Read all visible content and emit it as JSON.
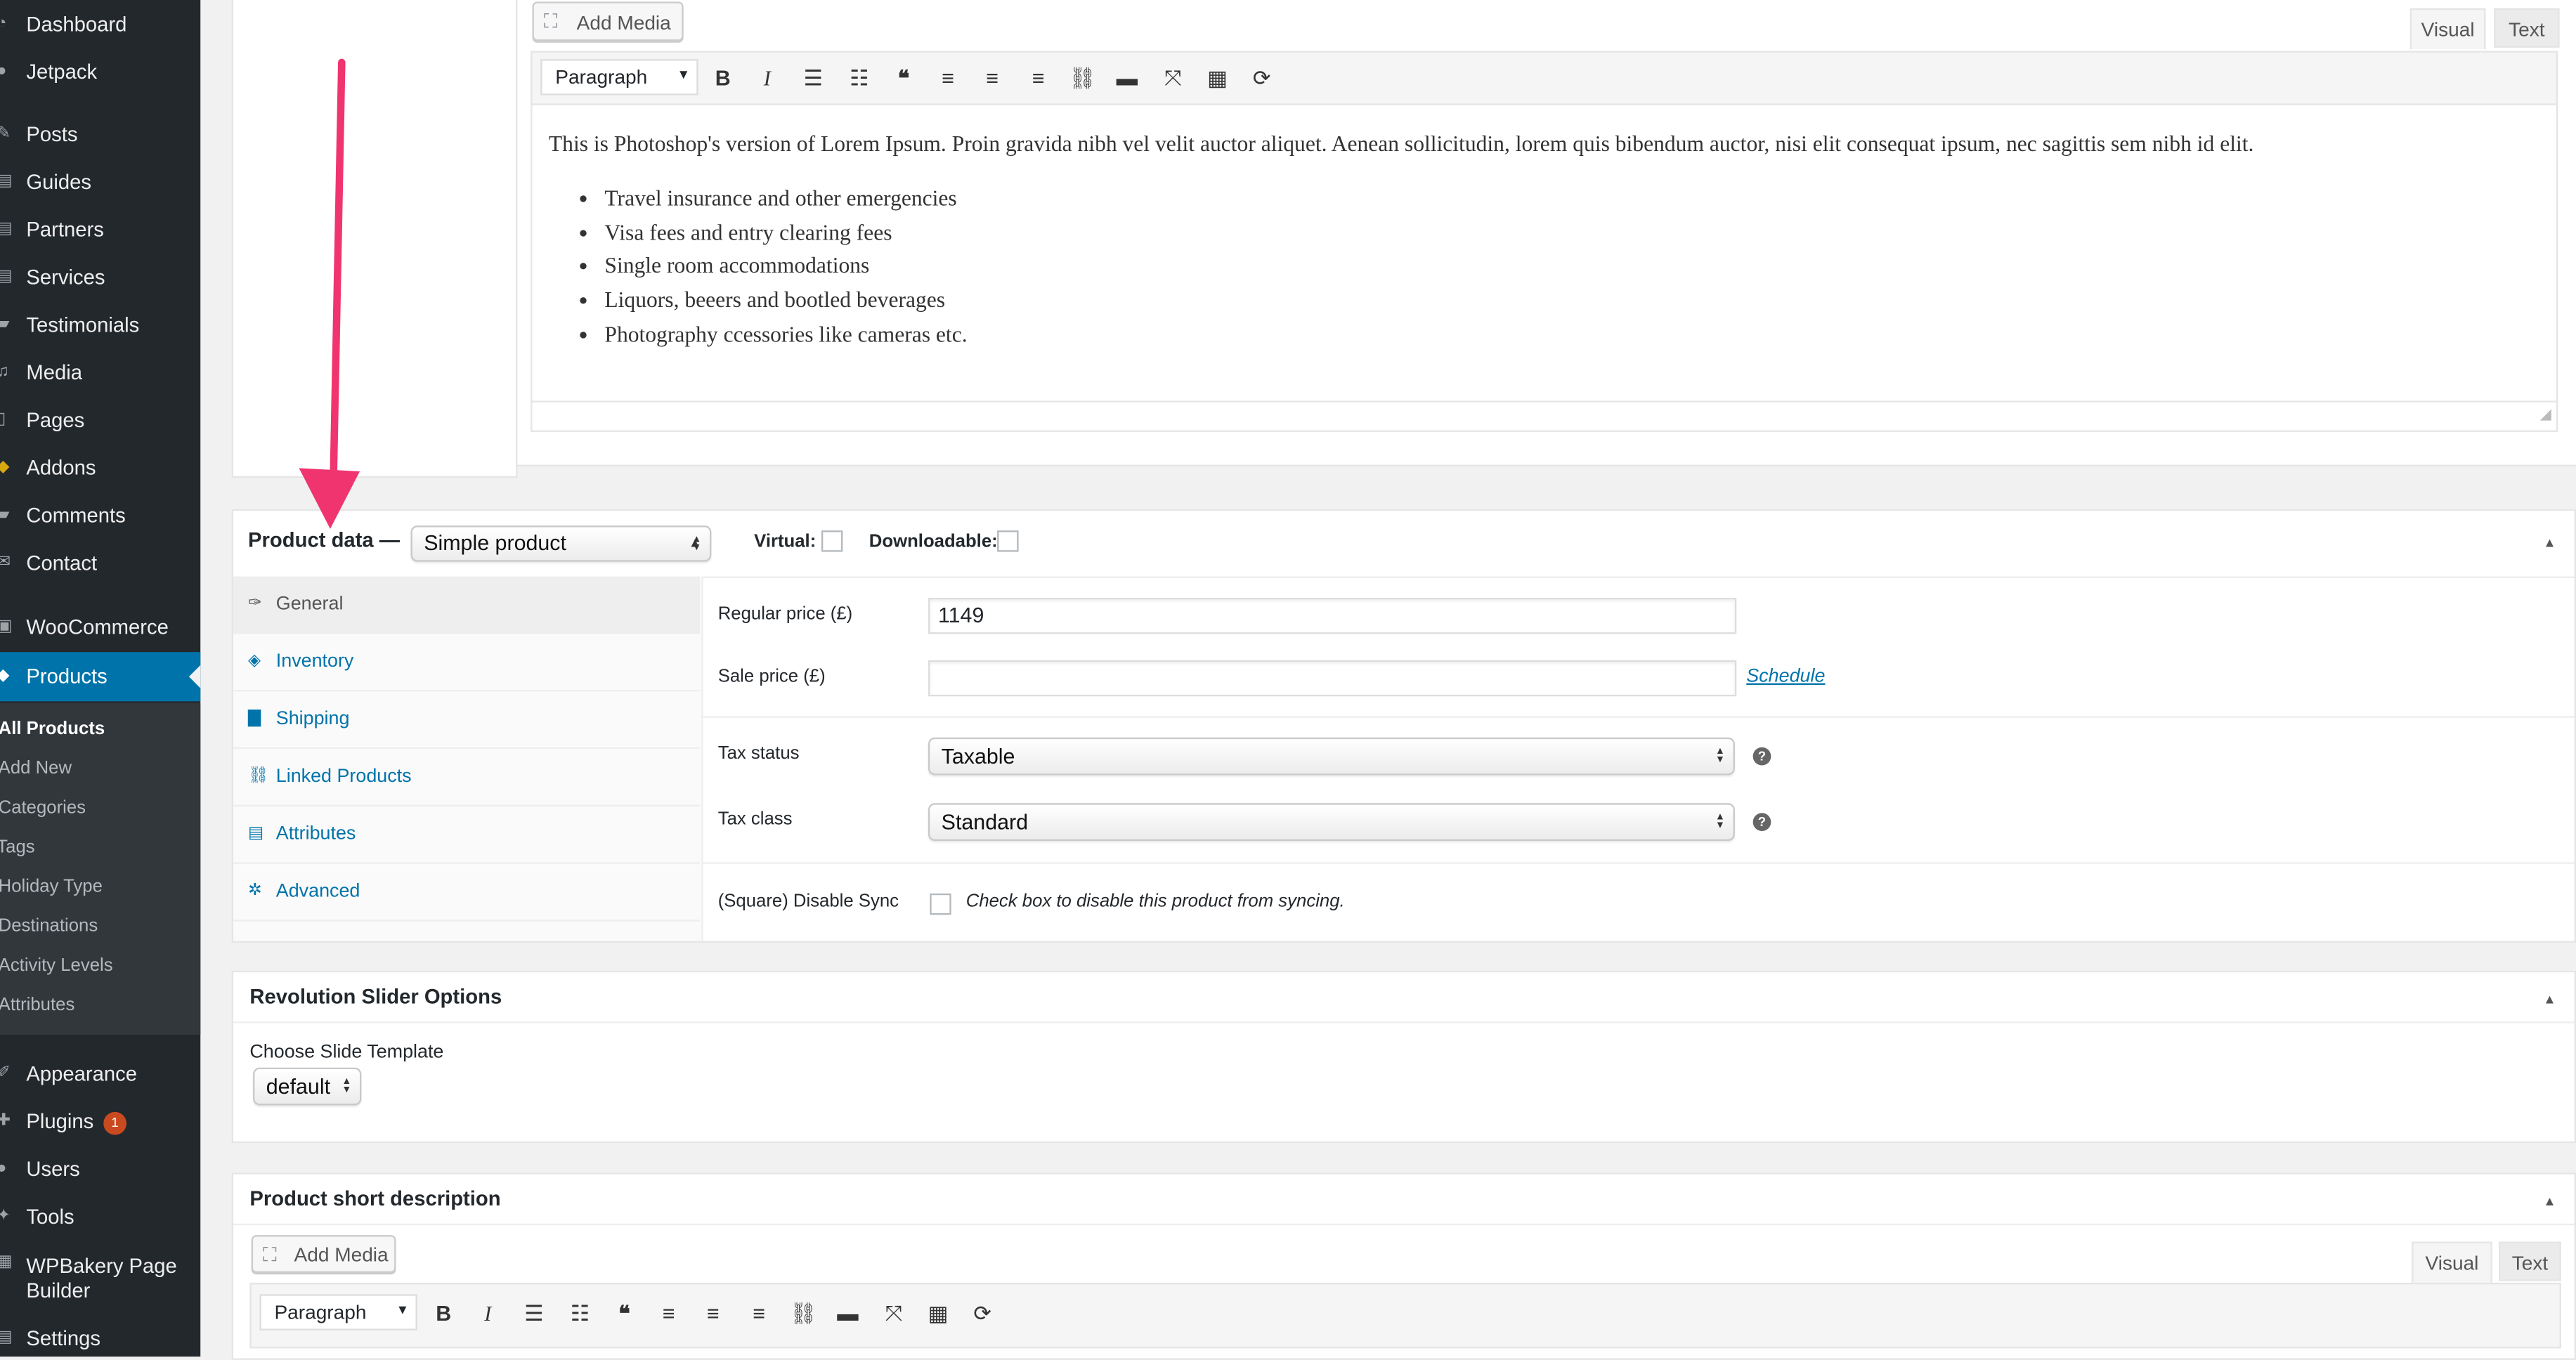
{
  "sidebar": {
    "items": [
      {
        "label": "Dashboard",
        "icon": "dashboard-icon"
      },
      {
        "label": "Jetpack",
        "icon": "jetpack-icon"
      },
      {
        "label": "Posts",
        "icon": "pin-icon"
      },
      {
        "label": "Guides",
        "icon": "page-icon"
      },
      {
        "label": "Partners",
        "icon": "page-icon"
      },
      {
        "label": "Services",
        "icon": "page-icon"
      },
      {
        "label": "Testimonials",
        "icon": "comment-icon"
      },
      {
        "label": "Media",
        "icon": "media-icon"
      },
      {
        "label": "Pages",
        "icon": "pages-icon"
      },
      {
        "label": "Addons",
        "icon": "addons-icon"
      },
      {
        "label": "Comments",
        "icon": "comments-icon"
      },
      {
        "label": "Contact",
        "icon": "mail-icon"
      },
      {
        "label": "WooCommerce",
        "icon": "woocommerce-icon"
      },
      {
        "label": "Products",
        "icon": "products-icon"
      },
      {
        "label": "Appearance",
        "icon": "brush-icon"
      },
      {
        "label": "Plugins",
        "icon": "plugin-icon",
        "badge": "1"
      },
      {
        "label": "Users",
        "icon": "users-icon"
      },
      {
        "label": "Tools",
        "icon": "tools-icon"
      },
      {
        "label": "WPBakery Page Builder",
        "icon": "builder-icon"
      },
      {
        "label": "Settings",
        "icon": "settings-icon"
      }
    ],
    "submenu": [
      "All Products",
      "Add New",
      "Categories",
      "Tags",
      "Holiday Type",
      "Destinations",
      "Activity Levels",
      "Attributes"
    ]
  },
  "editor": {
    "add_media": "Add Media",
    "tab_visual": "Visual",
    "tab_text": "Text",
    "format_select": "Paragraph",
    "paragraph": "This is Photoshop's version of Lorem Ipsum. Proin gravida nibh vel velit auctor aliquet. Aenean sollicitudin, lorem quis bibendum auctor, nisi elit consequat ipsum, nec sagittis sem nibh id elit.",
    "bullets": [
      "Travel insurance and other emergencies",
      "Visa fees and entry clearing fees",
      "Single room accommodations",
      "Liquors, beeers and bootled beverages",
      "Photography ccessories like cameras etc."
    ]
  },
  "product_data": {
    "title": "Product data —",
    "type_select": "Simple product",
    "virtual_label": "Virtual:",
    "downloadable_label": "Downloadable:",
    "tabs": [
      "General",
      "Inventory",
      "Shipping",
      "Linked Products",
      "Attributes",
      "Advanced"
    ],
    "regular_price_label": "Regular price (£)",
    "regular_price_value": "1149",
    "sale_price_label": "Sale price (£)",
    "sale_price_value": "",
    "schedule_link": "Schedule",
    "tax_status_label": "Tax status",
    "tax_status_value": "Taxable",
    "tax_class_label": "Tax class",
    "tax_class_value": "Standard",
    "square_label": "(Square) Disable Sync",
    "square_description": "Check box to disable this product from syncing."
  },
  "revslider": {
    "title": "Revolution Slider Options",
    "template_label": "Choose Slide Template",
    "template_value": "default"
  },
  "short_description": {
    "title": "Product short description",
    "add_media": "Add Media",
    "tab_visual": "Visual",
    "tab_text": "Text",
    "format_select": "Paragraph"
  },
  "colors": {
    "sidebar_bg": "#23282d",
    "active_menu": "#0073aa",
    "link": "#0073aa",
    "annotation_arrow": "#f0346f",
    "badge": "#ca4a1f"
  }
}
